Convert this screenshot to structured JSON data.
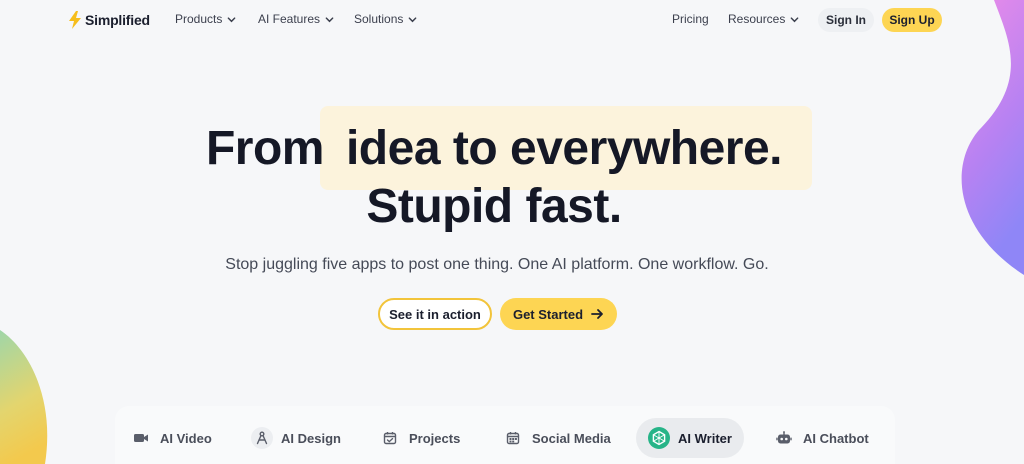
{
  "brand": {
    "name": "Simplified",
    "accent": "#fdd553",
    "logo_color": "#f6be1c"
  },
  "nav": {
    "left_items": [
      {
        "label": "Products",
        "has_dropdown": true
      },
      {
        "label": "AI Features",
        "has_dropdown": true
      },
      {
        "label": "Solutions",
        "has_dropdown": true
      }
    ],
    "right_items": [
      {
        "label": "Pricing",
        "has_dropdown": false
      },
      {
        "label": "Resources",
        "has_dropdown": true
      }
    ],
    "sign_in": "Sign In",
    "sign_up": "Sign Up"
  },
  "hero": {
    "headline_part_a": "From",
    "headline_part_b": "idea to everywhere.",
    "headline_line2": "Stupid fast.",
    "subtitle": "Stop juggling five apps to post one thing. One AI platform. One workflow. Go.",
    "cta_secondary": "See it in action",
    "cta_primary": "Get Started"
  },
  "tabs": [
    {
      "label": "AI Video",
      "icon": "video-camera-icon",
      "active": false
    },
    {
      "label": "AI Design",
      "icon": "design-compass-icon",
      "active": false
    },
    {
      "label": "Projects",
      "icon": "calendar-check-icon",
      "active": false
    },
    {
      "label": "Social Media",
      "icon": "calendar-grid-icon",
      "active": false
    },
    {
      "label": "AI Writer",
      "icon": "ai-writer-hexagon-icon",
      "active": true
    },
    {
      "label": "AI Chatbot",
      "icon": "robot-icon",
      "active": false
    }
  ]
}
